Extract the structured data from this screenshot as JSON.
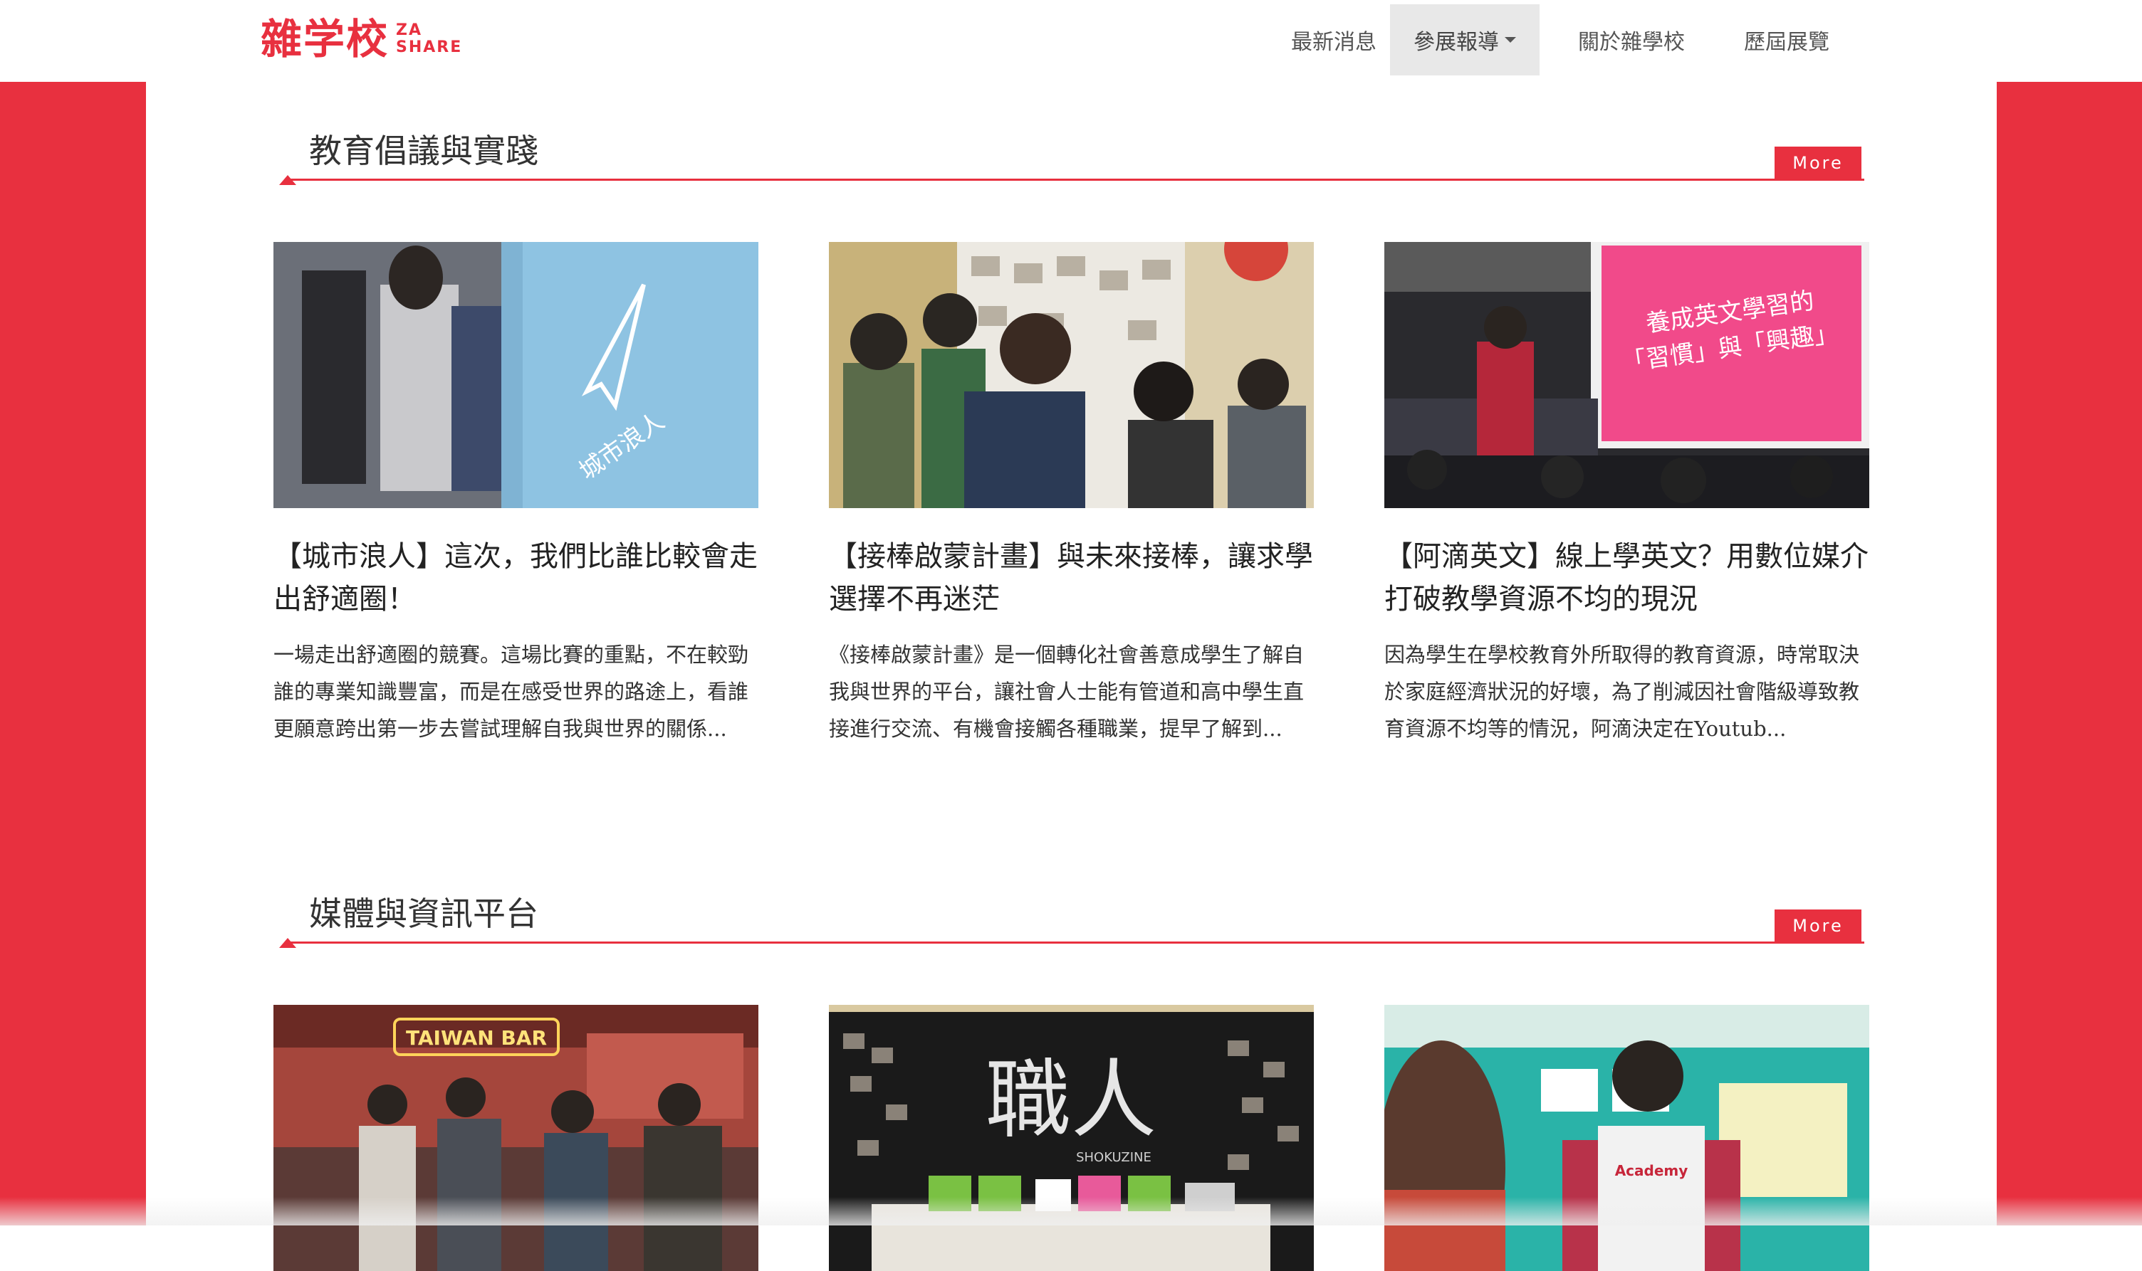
{
  "brand": {
    "name_cn": "雜学校",
    "name_en_1": "ZA",
    "name_en_2": "SHARE",
    "color": "#e8303f"
  },
  "nav": {
    "items": [
      {
        "label": "最新消息"
      },
      {
        "label": "參展報導"
      },
      {
        "label": "關於雜學校"
      },
      {
        "label": "歷屆展覽"
      }
    ]
  },
  "sections": [
    {
      "title": "教育倡議與實踐",
      "more_label": "More",
      "cards": [
        {
          "title": "【城市浪人】這次，我們比誰比較會走出舒適圈！",
          "excerpt": "一場走出舒適圈的競賽。這場比賽的重點，不在較勁誰的專業知識豐富，而是在感受世界的路途上，看誰更願意跨出第一步去嘗試理解自我與世界的關係..."
        },
        {
          "title": "【接棒啟蒙計畫】與未來接棒，讓求學選擇不再迷茫",
          "excerpt": "《接棒啟蒙計畫》是一個轉化社會善意成學生了解自我與世界的平台，讓社會人士能有管道和高中學生直接進行交流、有機會接觸各種職業，提早了解到..."
        },
        {
          "title": "【阿滴英文】線上學英文？用數位媒介打破教學資源不均的現況",
          "excerpt": "因為學生在學校教育外所取得的教育資源，時常取決於家庭經濟狀況的好壞，為了削減因社會階級導致教育資源不均等的情況，阿滴決定在Youtub...",
          "slide_text_1": "養成英文學習的",
          "slide_text_2": "「習慣」與「興趣」"
        }
      ]
    },
    {
      "title": "媒體與資訊平台",
      "more_label": "More",
      "cards": [
        {
          "sign_text": "TAIWAN BAR"
        },
        {
          "sign_text": "職人",
          "sign_sub": "SHOKUZINE"
        },
        {
          "shirt_text": "Academy"
        }
      ]
    }
  ]
}
